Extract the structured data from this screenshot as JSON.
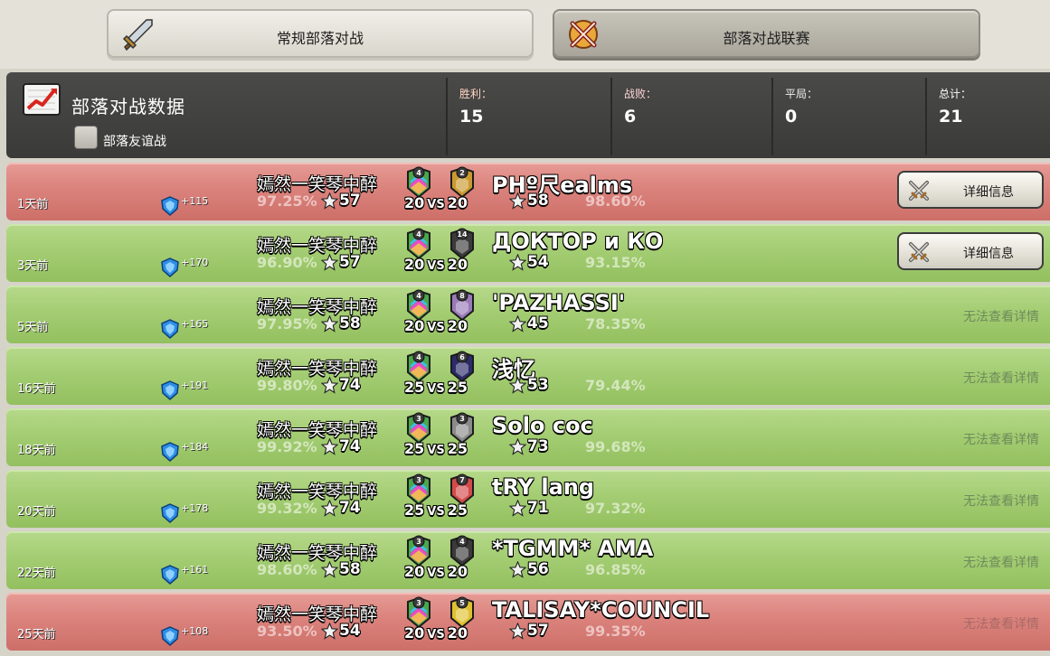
{
  "tabs": {
    "normal_label": "常规部落对战",
    "league_label": "部落对战联赛"
  },
  "stats": {
    "title": "部落对战数据",
    "friendly_label": "部落友谊战",
    "win_label": "胜利：",
    "win_value": "15",
    "lose_label": "战败：",
    "lose_value": "6",
    "draw_label": "平局：",
    "draw_value": "0",
    "total_label": "总计：",
    "total_value": "21"
  },
  "colors": {
    "win_row": "#a4cd73",
    "loss_row": "#db827c",
    "header_bg": "#3f3f3d"
  },
  "wars": [
    {
      "result": "loss",
      "ago": "1天前",
      "gain": "+115",
      "our_name": "嫣然一笑琴中醉",
      "our_pct": "97.25%",
      "our_stars": "57",
      "our_level": "4",
      "their_level": "2",
      "size_ours": "20",
      "vs": "VS",
      "size_theirs": "20",
      "their_name": "PHº尺ealms",
      "their_pct": "98.60%",
      "their_stars": "58",
      "action": "详细信息",
      "their_badge_color": "#c99a30"
    },
    {
      "result": "win",
      "ago": "3天前",
      "gain": "+170",
      "our_name": "嫣然一笑琴中醉",
      "our_pct": "96.90%",
      "our_stars": "57",
      "our_level": "4",
      "their_level": "14",
      "size_ours": "20",
      "vs": "VS",
      "size_theirs": "20",
      "their_name": "ДОКТОР и КО",
      "their_pct": "93.15%",
      "their_stars": "54",
      "action": "详细信息",
      "their_badge_color": "#3b3b3b"
    },
    {
      "result": "win",
      "ago": "5天前",
      "gain": "+165",
      "our_name": "嫣然一笑琴中醉",
      "our_pct": "97.95%",
      "our_stars": "58",
      "our_level": "4",
      "their_level": "8",
      "size_ours": "20",
      "vs": "VS",
      "size_theirs": "20",
      "their_name": "'PAZHASSI'",
      "their_pct": "78.35%",
      "their_stars": "45",
      "action": "无法查看详情",
      "their_badge_color": "#9a7ab8"
    },
    {
      "result": "win",
      "ago": "16天前",
      "gain": "+191",
      "our_name": "嫣然一笑琴中醉",
      "our_pct": "99.80%",
      "our_stars": "74",
      "our_level": "4",
      "their_level": "6",
      "size_ours": "25",
      "vs": "VS",
      "size_theirs": "25",
      "their_name": "浅忆",
      "their_pct": "79.44%",
      "their_stars": "53",
      "action": "无法查看详情",
      "their_badge_color": "#2c2c6a"
    },
    {
      "result": "win",
      "ago": "18天前",
      "gain": "+184",
      "our_name": "嫣然一笑琴中醉",
      "our_pct": "99.92%",
      "our_stars": "74",
      "our_level": "3",
      "their_level": "3",
      "size_ours": "25",
      "vs": "VS",
      "size_theirs": "25",
      "their_name": "Solo coc",
      "their_pct": "99.68%",
      "their_stars": "73",
      "action": "无法查看详情",
      "their_badge_color": "#8a8a8a"
    },
    {
      "result": "win",
      "ago": "20天前",
      "gain": "+178",
      "our_name": "嫣然一笑琴中醉",
      "our_pct": "99.32%",
      "our_stars": "74",
      "our_level": "3",
      "their_level": "7",
      "size_ours": "25",
      "vs": "VS",
      "size_theirs": "25",
      "their_name": "tRY lang",
      "their_pct": "97.32%",
      "their_stars": "71",
      "action": "无法查看详情",
      "their_badge_color": "#d44a4a"
    },
    {
      "result": "win",
      "ago": "22天前",
      "gain": "+161",
      "our_name": "嫣然一笑琴中醉",
      "our_pct": "98.60%",
      "our_stars": "58",
      "our_level": "3",
      "their_level": "4",
      "size_ours": "20",
      "vs": "VS",
      "size_theirs": "20",
      "their_name": "*TGMM* AMA",
      "their_pct": "96.85%",
      "their_stars": "56",
      "action": "无法查看详情",
      "their_badge_color": "#3a3a3a"
    },
    {
      "result": "loss",
      "ago": "25天前",
      "gain": "+108",
      "our_name": "嫣然一笑琴中醉",
      "our_pct": "93.50%",
      "our_stars": "54",
      "our_level": "3",
      "their_level": "5",
      "size_ours": "20",
      "vs": "VS",
      "size_theirs": "20",
      "their_name": "TALISAY*COUNCIL",
      "their_pct": "99.35%",
      "their_stars": "57",
      "action": "无法查看详情",
      "their_badge_color": "#e0c030"
    }
  ]
}
